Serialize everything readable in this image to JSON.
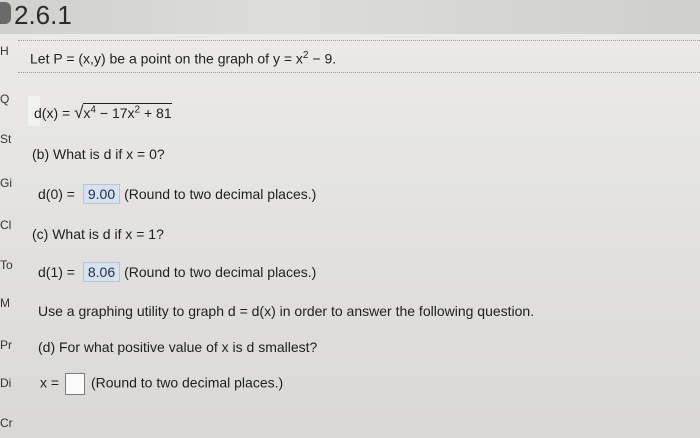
{
  "header": {
    "title": "2.6.1"
  },
  "sidebar": {
    "items": [
      {
        "label": "H"
      },
      {
        "label": "Q"
      },
      {
        "label": "St"
      },
      {
        "label": "Gi"
      },
      {
        "label": "Cl"
      },
      {
        "label": "To"
      },
      {
        "label": "M"
      },
      {
        "label": "Pr"
      },
      {
        "label": "Di"
      },
      {
        "label": "Cr"
      }
    ]
  },
  "problem": {
    "statement_prefix": "Let P = (x,y) be a point on the graph of y = x",
    "statement_exp": "2",
    "statement_suffix": " − 9.",
    "distance_label": "d(x) = ",
    "radicand_a": "x",
    "radicand_a_exp": "4",
    "radicand_b": " − 17x",
    "radicand_b_exp": "2",
    "radicand_c": " + 81",
    "part_b_question": "(b) What is d if x = 0?",
    "part_b_answer_label": "d(0) = ",
    "part_b_answer_value": "9.00",
    "part_b_note": "(Round to two decimal places.)",
    "part_c_question": "(c) What is d if x = 1?",
    "part_c_answer_label": "d(1) = ",
    "part_c_answer_value": "8.06",
    "part_c_note": "(Round to two decimal places.)",
    "graph_instruction": "Use a graphing utility to graph d = d(x) in order to answer the following question.",
    "part_d_question": "(d) For what positive value of x is d smallest?",
    "part_d_input_label": "x = ",
    "part_d_input_value": "",
    "part_d_note": "(Round to two decimal places.)"
  }
}
